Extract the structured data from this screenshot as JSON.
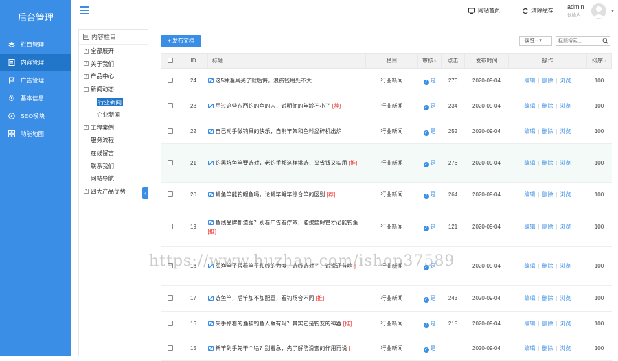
{
  "brand": "后台管理",
  "sidebar": {
    "items": [
      {
        "label": "栏目管理",
        "icon": "layers-icon",
        "active": false
      },
      {
        "label": "内容管理",
        "icon": "document-icon",
        "active": true
      },
      {
        "label": "广告管理",
        "icon": "flag-icon",
        "active": false
      },
      {
        "label": "基本信息",
        "icon": "gear-icon",
        "active": false
      },
      {
        "label": "SEO模块",
        "icon": "compass-icon",
        "active": false
      },
      {
        "label": "功能地图",
        "icon": "grid-icon",
        "active": false
      }
    ]
  },
  "topbar": {
    "home_label": "网站首页",
    "clear_cache_label": "清除缓存",
    "username": "admin",
    "role": "创始人"
  },
  "tree": {
    "title": "内容栏目",
    "nodes": [
      {
        "label": "全部展开",
        "box": "+"
      },
      {
        "label": "关于我们",
        "box": "+"
      },
      {
        "label": "产品中心",
        "box": "+"
      },
      {
        "label": "新闻动态",
        "box": "-"
      },
      {
        "label": "行业新闻",
        "child": true,
        "selected": true
      },
      {
        "label": "企业新闻",
        "child": true
      },
      {
        "label": "工程案例",
        "box": "+"
      },
      {
        "label": "服务流程"
      },
      {
        "label": "在线留言"
      },
      {
        "label": "联系我们"
      },
      {
        "label": "网站导航"
      },
      {
        "label": "四大产品优势",
        "box": "+"
      }
    ]
  },
  "toolbar": {
    "publish_label": "+ 发布文档",
    "attr_select": "--属性--",
    "search_placeholder": "标题搜索..."
  },
  "table": {
    "headers": {
      "id": "ID",
      "title": "标题",
      "column": "栏目",
      "audit": "审核",
      "clicks": "点击",
      "date": "发布时间",
      "ops": "操作",
      "sort": "排序"
    },
    "op_edit": "编辑",
    "op_delete": "删除",
    "op_browse": "浏览",
    "audit_yes": "是",
    "rows": [
      {
        "id": "24",
        "title": "这5种渔具买了就后悔，浪费钱用处不大",
        "tag": "",
        "column": "行业新闻",
        "clicks": "276",
        "date": "2020-09-04",
        "sort": "100",
        "h": 36
      },
      {
        "id": "23",
        "title": "用过这些东西钓的鱼的人，说明你的年龄不小了",
        "tag": "[荐]",
        "column": "行业新闻",
        "clicks": "234",
        "date": "2020-09-04",
        "sort": "100",
        "h": 38
      },
      {
        "id": "22",
        "title": "自己动手做钓具的快乐，自制竿架和鱼料盆碎机出炉",
        "tag": "",
        "column": "行业新闻",
        "clicks": "252",
        "date": "2020-09-04",
        "sort": "100",
        "h": 36
      },
      {
        "id": "21",
        "title": "钓黑坑鱼竿要选对，老钓手都这样挑选，又省钱又实用",
        "tag": "[推]",
        "column": "行业新闻",
        "clicks": "276",
        "date": "2020-09-04",
        "sort": "100",
        "h": 56,
        "highlight": true
      },
      {
        "id": "20",
        "title": "鲫鱼竿能钓鲤鱼吗，论鲫竿鲤竿综合竿的区别",
        "tag": "[荐]",
        "column": "行业新闻",
        "clicks": "264",
        "date": "2020-09-04",
        "sort": "100",
        "h": 36
      },
      {
        "id": "19",
        "title": "鱼线品牌都渣强？别看广告看疗效，能拔整鲟管才必能钓鱼",
        "tag": "[推]",
        "column": "行业新闻",
        "clicks": "121",
        "date": "2020-09-04",
        "sort": "100",
        "h": 58
      },
      {
        "id": "18",
        "title": "买渔竿子得看竿子和线的力度，选线选对了，说说还有啥",
        "tag": "]",
        "column": "行业新闻",
        "clicks": "",
        "date": "2020-09-04",
        "sort": "100",
        "h": 56
      },
      {
        "id": "17",
        "title": "选鱼竿，后竿加不加配重，看钓场合不同",
        "tag": "[推]",
        "column": "行业新闻",
        "clicks": "243",
        "date": "2020-09-04",
        "sort": "100",
        "h": 38
      },
      {
        "id": "16",
        "title": "失手掉着的渔被钓鱼人瞩有吗？其实它是钓友的神器",
        "tag": "[推]",
        "column": "行业新闻",
        "clicks": "215",
        "date": "2020-09-04",
        "sort": "100",
        "h": 36
      },
      {
        "id": "15",
        "title": "新竿到手先干个啥？别着急，先了解防滑套的作用再说",
        "tag": "[",
        "column": "行业新闻",
        "clicks": "",
        "date": "2020-09-04",
        "sort": "100",
        "h": 36
      }
    ]
  },
  "watermark": "https://www.huzhan.com/ishop37589",
  "colors": {
    "accent": "#3a8ee6",
    "sidebar_active": "#2176c9",
    "tag_red": "#e33"
  }
}
